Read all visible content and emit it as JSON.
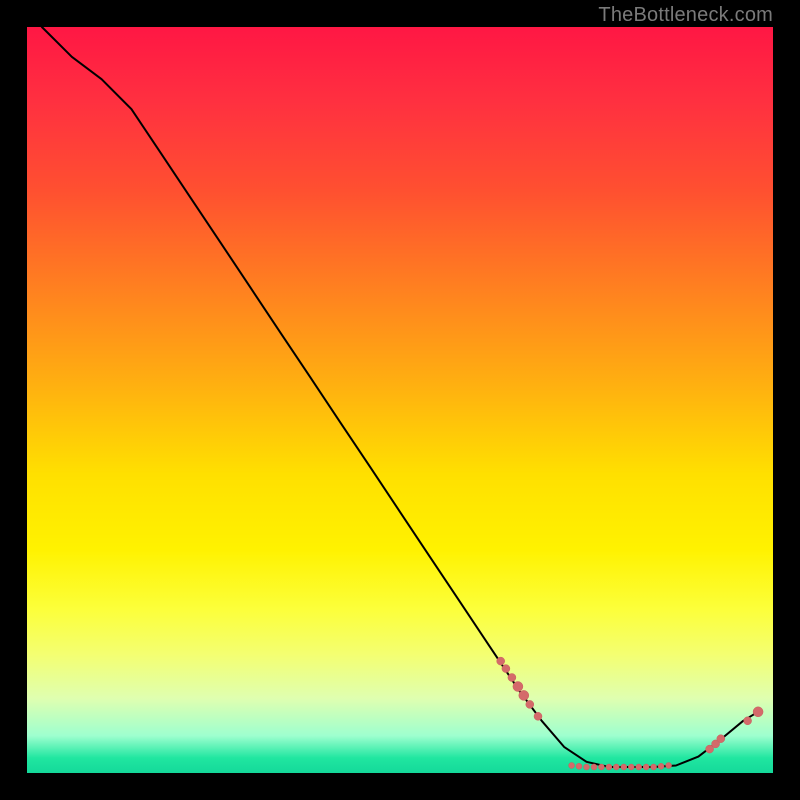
{
  "watermark": "TheBottleneck.com",
  "colors": {
    "curve_stroke": "#000000",
    "marker_fill": "#d46a6a",
    "marker_stroke": "#c95f5f"
  },
  "chart_data": {
    "type": "line",
    "title": "",
    "xlabel": "",
    "ylabel": "",
    "xlim": [
      0,
      100
    ],
    "ylim": [
      0,
      100
    ],
    "curve": [
      {
        "x": 2,
        "y": 100
      },
      {
        "x": 6,
        "y": 96
      },
      {
        "x": 10,
        "y": 93
      },
      {
        "x": 14,
        "y": 89
      },
      {
        "x": 18,
        "y": 83
      },
      {
        "x": 22,
        "y": 77
      },
      {
        "x": 26,
        "y": 71
      },
      {
        "x": 30,
        "y": 65
      },
      {
        "x": 34,
        "y": 59
      },
      {
        "x": 38,
        "y": 53
      },
      {
        "x": 42,
        "y": 47
      },
      {
        "x": 46,
        "y": 41
      },
      {
        "x": 50,
        "y": 35
      },
      {
        "x": 54,
        "y": 29
      },
      {
        "x": 58,
        "y": 23
      },
      {
        "x": 62,
        "y": 17
      },
      {
        "x": 66,
        "y": 11
      },
      {
        "x": 69,
        "y": 7
      },
      {
        "x": 72,
        "y": 3.5
      },
      {
        "x": 75,
        "y": 1.5
      },
      {
        "x": 78,
        "y": 0.8
      },
      {
        "x": 81,
        "y": 0.8
      },
      {
        "x": 84,
        "y": 0.8
      },
      {
        "x": 87,
        "y": 1.0
      },
      {
        "x": 90,
        "y": 2.2
      },
      {
        "x": 93,
        "y": 4.5
      },
      {
        "x": 96,
        "y": 7.0
      },
      {
        "x": 98,
        "y": 8.2
      }
    ],
    "markers": [
      {
        "x": 63.5,
        "y": 15.0,
        "r": 4
      },
      {
        "x": 64.2,
        "y": 14.0,
        "r": 4
      },
      {
        "x": 65.0,
        "y": 12.8,
        "r": 4
      },
      {
        "x": 65.8,
        "y": 11.6,
        "r": 5
      },
      {
        "x": 66.6,
        "y": 10.4,
        "r": 5
      },
      {
        "x": 67.4,
        "y": 9.2,
        "r": 4
      },
      {
        "x": 68.5,
        "y": 7.6,
        "r": 4
      },
      {
        "x": 73.0,
        "y": 1.0,
        "r": 3
      },
      {
        "x": 74.0,
        "y": 0.9,
        "r": 3
      },
      {
        "x": 75.0,
        "y": 0.8,
        "r": 3
      },
      {
        "x": 76.0,
        "y": 0.8,
        "r": 3
      },
      {
        "x": 77.0,
        "y": 0.8,
        "r": 3
      },
      {
        "x": 78.0,
        "y": 0.8,
        "r": 3
      },
      {
        "x": 79.0,
        "y": 0.8,
        "r": 3
      },
      {
        "x": 80.0,
        "y": 0.8,
        "r": 3
      },
      {
        "x": 81.0,
        "y": 0.8,
        "r": 3
      },
      {
        "x": 82.0,
        "y": 0.8,
        "r": 3
      },
      {
        "x": 83.0,
        "y": 0.8,
        "r": 3
      },
      {
        "x": 84.0,
        "y": 0.8,
        "r": 3
      },
      {
        "x": 85.0,
        "y": 0.9,
        "r": 3
      },
      {
        "x": 86.0,
        "y": 1.0,
        "r": 3
      },
      {
        "x": 91.5,
        "y": 3.2,
        "r": 4
      },
      {
        "x": 92.3,
        "y": 3.9,
        "r": 4
      },
      {
        "x": 93.0,
        "y": 4.6,
        "r": 4
      },
      {
        "x": 96.6,
        "y": 7.0,
        "r": 4
      },
      {
        "x": 98.0,
        "y": 8.2,
        "r": 5
      }
    ]
  }
}
